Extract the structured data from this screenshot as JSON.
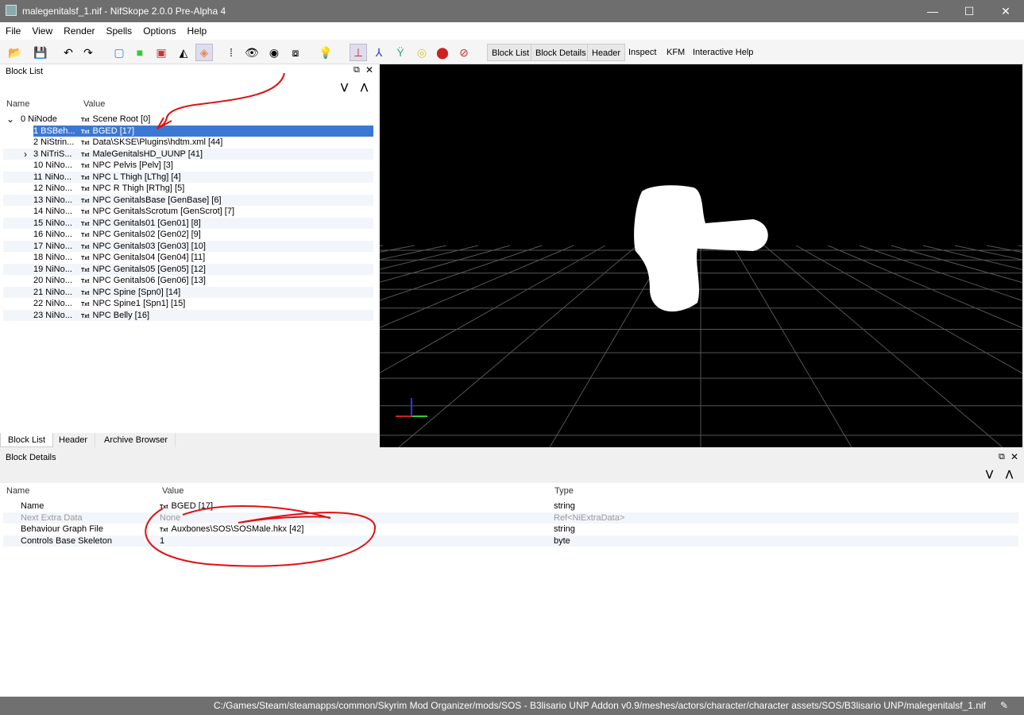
{
  "window": {
    "title": "malegenitalsf_1.nif - NifSkope 2.0.0 Pre-Alpha 4",
    "controls": [
      "minimize",
      "maximize",
      "close"
    ]
  },
  "menu": [
    "File",
    "View",
    "Render",
    "Spells",
    "Options",
    "Help"
  ],
  "toolbar": {
    "icons": [
      "open-icon",
      "save-icon",
      "undo-icon",
      "redo-icon",
      "view-top-icon",
      "view-front-icon",
      "view-side-icon",
      "flip-icon",
      "perspective-cube-icon",
      "walk-icon",
      "show-hidden-icon",
      "select-hidden-icon",
      "screenshot-icon",
      "lighting-icon",
      "show-axes-icon",
      "show-nodes-icon",
      "show-havok-icon",
      "show-constraints-icon",
      "show-markers-icon",
      "hide-hidden-icon"
    ],
    "buttons": [
      "Block List",
      "Block Details",
      "Header",
      "Inspect",
      "KFM",
      "Interactive Help"
    ]
  },
  "block_list": {
    "title": "Block List",
    "columns": [
      "Name",
      "Value"
    ],
    "rows": [
      {
        "name": "0 NiNode",
        "value": "Scene Root [0]",
        "expand": "expanded"
      },
      {
        "name": "1 BSBeh...",
        "value": "BGED [17]",
        "selected": true
      },
      {
        "name": "2 NiStrin...",
        "value": "Data\\SKSE\\Plugins\\hdtm.xml [44]"
      },
      {
        "name": "3 NiTriS...",
        "value": "MaleGenitalsHD_UUNP [41]",
        "expand": "collapsed"
      },
      {
        "name": "10 NiNo...",
        "value": "NPC Pelvis [Pelv] [3]"
      },
      {
        "name": "11 NiNo...",
        "value": "NPC L Thigh [LThg] [4]"
      },
      {
        "name": "12 NiNo...",
        "value": "NPC R Thigh [RThg] [5]"
      },
      {
        "name": "13 NiNo...",
        "value": "NPC GenitalsBase [GenBase] [6]"
      },
      {
        "name": "14 NiNo...",
        "value": "NPC GenitalsScrotum [GenScrot] [7]"
      },
      {
        "name": "15 NiNo...",
        "value": "NPC Genitals01 [Gen01] [8]"
      },
      {
        "name": "16 NiNo...",
        "value": "NPC Genitals02 [Gen02] [9]"
      },
      {
        "name": "17 NiNo...",
        "value": "NPC Genitals03 [Gen03] [10]"
      },
      {
        "name": "18 NiNo...",
        "value": "NPC Genitals04 [Gen04] [11]"
      },
      {
        "name": "19 NiNo...",
        "value": "NPC Genitals05 [Gen05] [12]"
      },
      {
        "name": "20 NiNo...",
        "value": "NPC Genitals06 [Gen06] [13]"
      },
      {
        "name": "21 NiNo...",
        "value": "NPC Spine [Spn0] [14]"
      },
      {
        "name": "22 NiNo...",
        "value": "NPC Spine1 [Spn1] [15]"
      },
      {
        "name": "23 NiNo...",
        "value": "NPC Belly [16]"
      }
    ],
    "txt_tag": "Txt",
    "tabs": [
      "Block List",
      "Header",
      "Archive Browser"
    ]
  },
  "block_details": {
    "title": "Block Details",
    "columns": [
      "Name",
      "Value",
      "Type"
    ],
    "rows": [
      {
        "name": "Name",
        "value": "BGED [17]",
        "type": "string",
        "txt": true
      },
      {
        "name": "Next Extra Data",
        "value": "None",
        "type": "Ref<NiExtraData>",
        "disabled": true
      },
      {
        "name": "Behaviour Graph File",
        "value": "Auxbones\\SOS\\SOSMale.hkx [42]",
        "type": "string",
        "txt": true
      },
      {
        "name": "Controls Base Skeleton",
        "value": "1",
        "type": "byte"
      }
    ]
  },
  "status": {
    "path": "C:/Games/Steam/steamapps/common/Skyrim Mod Organizer/mods/SOS - B3lisario UNP Addon v0.9/meshes/actors/character/character assets/SOS/B3lisario UNP/malegenitalsf_1.nif"
  },
  "colors": {
    "selection": "#3b78d4",
    "annotation": "#e01010",
    "viewport_bg": "#000000"
  }
}
